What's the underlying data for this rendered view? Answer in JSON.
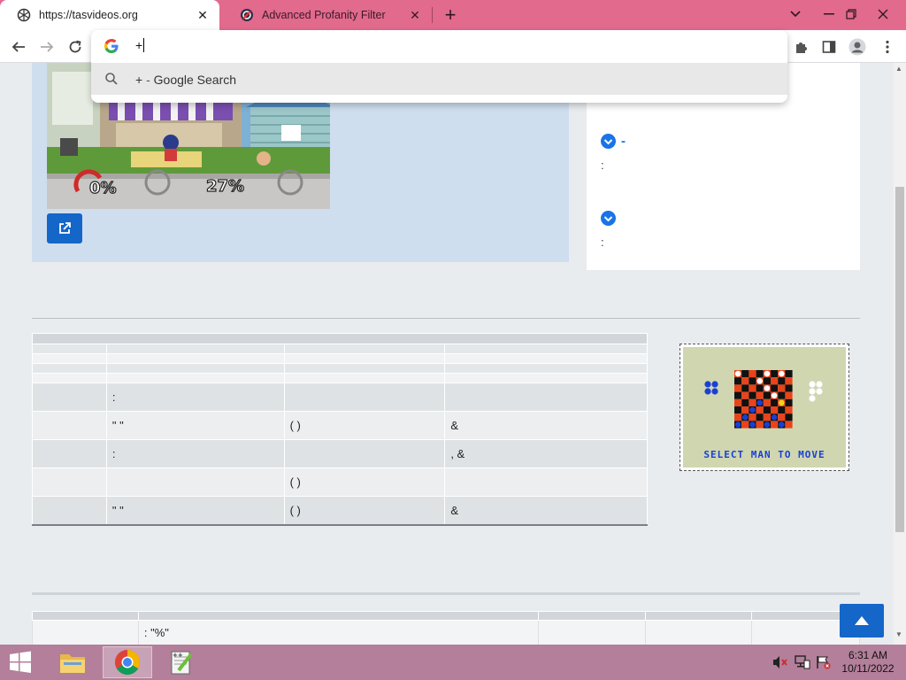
{
  "browser": {
    "tabs": [
      {
        "title": "https://tasvideos.org",
        "active": true
      },
      {
        "title": "Advanced Profanity Filter",
        "active": false
      }
    ],
    "colors": {
      "tabstrip": "#e26a8d",
      "accent": "#1a73e8"
    }
  },
  "omnibox": {
    "typed": "+",
    "suggestion": {
      "query": "+",
      "separator": "-",
      "engine_label": "Google Search"
    }
  },
  "sidebar_card": {
    "items": [
      {
        "dash": "-",
        "colon": ":"
      },
      {
        "dash": "",
        "colon": ":"
      }
    ]
  },
  "publication_table": {
    "rows": [
      [
        "",
        ":",
        "",
        ""
      ],
      [
        "",
        "\" \"",
        "( )",
        "&"
      ],
      [
        "",
        ":",
        "",
        ", &"
      ],
      [
        "",
        "",
        "( )",
        ""
      ],
      [
        "",
        "\" \"",
        "( )",
        "&"
      ]
    ]
  },
  "game_thumb": {
    "caption": "SELECT MAN TO MOVE"
  },
  "bottom_table": {
    "row": [
      "",
      ": \"%\"",
      "",
      "",
      ""
    ]
  },
  "taskbar": {
    "time": "6:31 AM",
    "date": "10/11/2022"
  }
}
